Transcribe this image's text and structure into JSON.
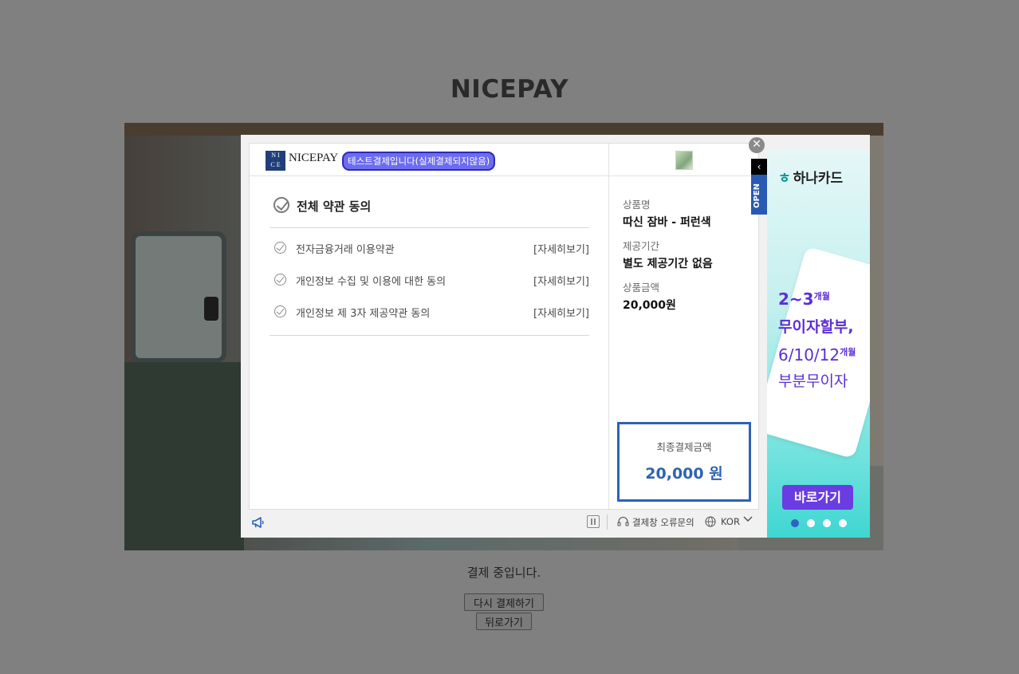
{
  "page": {
    "site_title": "NICEPAY",
    "status_text": "결제 중입니다.",
    "retry_label": "다시 결제하기",
    "back_label": "뒤로가기"
  },
  "modal": {
    "logo_letters": [
      "N",
      "I",
      "C",
      "E"
    ],
    "logo_text": "NICEPAY",
    "test_badge": "테스트결제입니다(실제결제되지않음)",
    "all_agree_label": "전체 약관 동의",
    "terms": [
      {
        "label": "전자금융거래 이용약관",
        "link": "[자세히보기]"
      },
      {
        "label": "개인정보 수집 및 이용에 대한 동의",
        "link": "[자세히보기]"
      },
      {
        "label": "개인정보 제 3자 제공약관 동의",
        "link": "[자세히보기]"
      }
    ],
    "product_name_label": "상품명",
    "product_name": "따신 잠바 - 퍼런색",
    "period_label": "제공기간",
    "period_value": "별도 제공기간 없음",
    "price_label": "상품금액",
    "price_value": "20,000원",
    "total_label": "최종결제금액",
    "total_value": "20,000 원",
    "footer": {
      "error_inquiry": "결제창 오류문의",
      "language": "KOR"
    },
    "close_icon": "✕",
    "open_tab_label": "OPEN"
  },
  "ad": {
    "brand": "하나카드",
    "line1_main": "2~3",
    "line1_sup": "개월",
    "line2": "무이자할부,",
    "line3_main": "6/10/12",
    "line3_sup": "개월",
    "line4": "부분무이자",
    "cta": "바로가기",
    "slide_count": 4,
    "active_slide": 1
  },
  "colors": {
    "accent_blue": "#2e63b3",
    "badge_purple": "#6c6cf0",
    "ad_purple": "#5b2fd8",
    "ad_teal": "#3fd6d2"
  },
  "icons": {
    "check": "check-circle-icon",
    "megaphone": "megaphone-icon",
    "pause": "pause-icon",
    "headset": "headset-icon",
    "globe": "globe-icon",
    "chevron": "chevron-down-icon"
  }
}
